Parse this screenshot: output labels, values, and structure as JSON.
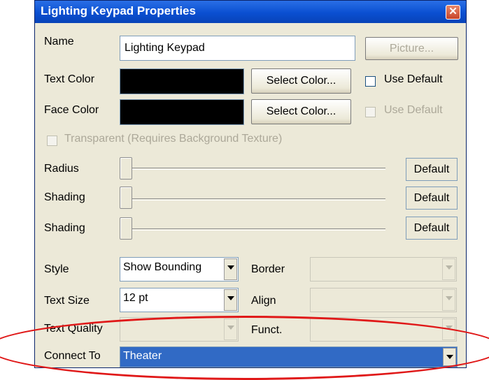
{
  "window": {
    "title": "Lighting Keypad Properties",
    "close_glyph": "✕"
  },
  "name_row": {
    "label": "Name",
    "value": "Lighting Keypad",
    "picture_button": "Picture..."
  },
  "text_color": {
    "label": "Text Color",
    "swatch_color": "#000000",
    "button": "Select Color...",
    "use_default_label": "Use Default",
    "use_default_checked": false
  },
  "face_color": {
    "label": "Face Color",
    "swatch_color": "#000000",
    "button": "Select Color...",
    "use_default_label": "Use Default",
    "use_default_checked": false
  },
  "transparent": {
    "label": "Transparent (Requires Background Texture)",
    "checked": false,
    "enabled": false
  },
  "sliders": [
    {
      "label": "Radius",
      "default_button": "Default",
      "value": 0
    },
    {
      "label": "Shading",
      "default_button": "Default",
      "value": 0
    },
    {
      "label": "Shading",
      "default_button": "Default",
      "value": 0
    }
  ],
  "style": {
    "label": "Style",
    "value": "Show Bounding"
  },
  "border": {
    "label": "Border",
    "value": ""
  },
  "text_size": {
    "label": "Text Size",
    "value": "12 pt"
  },
  "align": {
    "label": "Align",
    "value": ""
  },
  "text_quality": {
    "label": "Text Quality",
    "value": ""
  },
  "funct": {
    "label": "Funct.",
    "value": ""
  },
  "connect_to": {
    "label": "Connect To",
    "value": "Theater"
  },
  "colors": {
    "title_bar": "#0a4fd1",
    "dialog_bg": "#ece9d8",
    "selection": "#316ac5",
    "annotation": "#e01818"
  }
}
